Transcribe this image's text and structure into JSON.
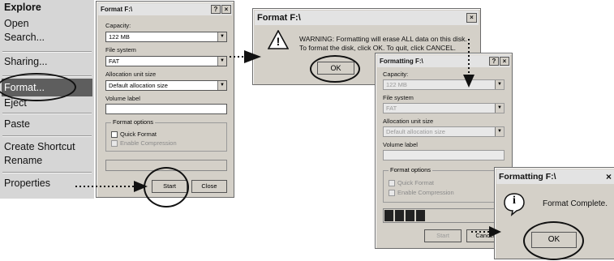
{
  "context_menu": {
    "items": [
      "Explore",
      "Open",
      "Search...",
      "Sharing...",
      "Format...",
      "Eject",
      "Paste",
      "Create Shortcut",
      "Rename",
      "Properties"
    ]
  },
  "dialog_format": {
    "title": "Format F:\\",
    "help_glyph": "?",
    "close_glyph": "×",
    "capacity_label": "Capacity:",
    "capacity_value": "122 MB",
    "filesystem_label": "File system",
    "filesystem_value": "FAT",
    "alloc_label": "Allocation unit size",
    "alloc_value": "Default allocation size",
    "volume_label": "Volume label",
    "volume_value": "",
    "options_label": "Format options",
    "quick_format": "Quick Format",
    "enable_compression": "Enable Compression",
    "start": "Start",
    "close": "Close"
  },
  "dialog_warning": {
    "title": "Format F:\\",
    "close_glyph": "×",
    "icon_glyph": "!",
    "message_line1": "WARNING: Formatting will erase ALL data on this disk.",
    "message_line2": "To format the disk, click OK. To quit, click CANCEL.",
    "ok": "OK"
  },
  "dialog_formatting": {
    "title": "Formatting F:\\",
    "help_glyph": "?",
    "close_glyph": "×",
    "capacity_label": "Capacity:",
    "capacity_value": "122 MB",
    "filesystem_label": "File system",
    "filesystem_value": "FAT",
    "alloc_label": "Allocation unit size",
    "alloc_value": "Default allocation size",
    "volume_label": "Volume label",
    "options_label": "Format options",
    "quick_format": "Quick Format",
    "enable_compression": "Enable Compression",
    "progress_fraction": 0.4,
    "start": "Start",
    "cancel": "Cancel"
  },
  "dialog_complete": {
    "title": "Formatting F:\\",
    "close_glyph": "×",
    "icon_glyph": "i",
    "message": "Format Complete.",
    "ok": "OK"
  }
}
